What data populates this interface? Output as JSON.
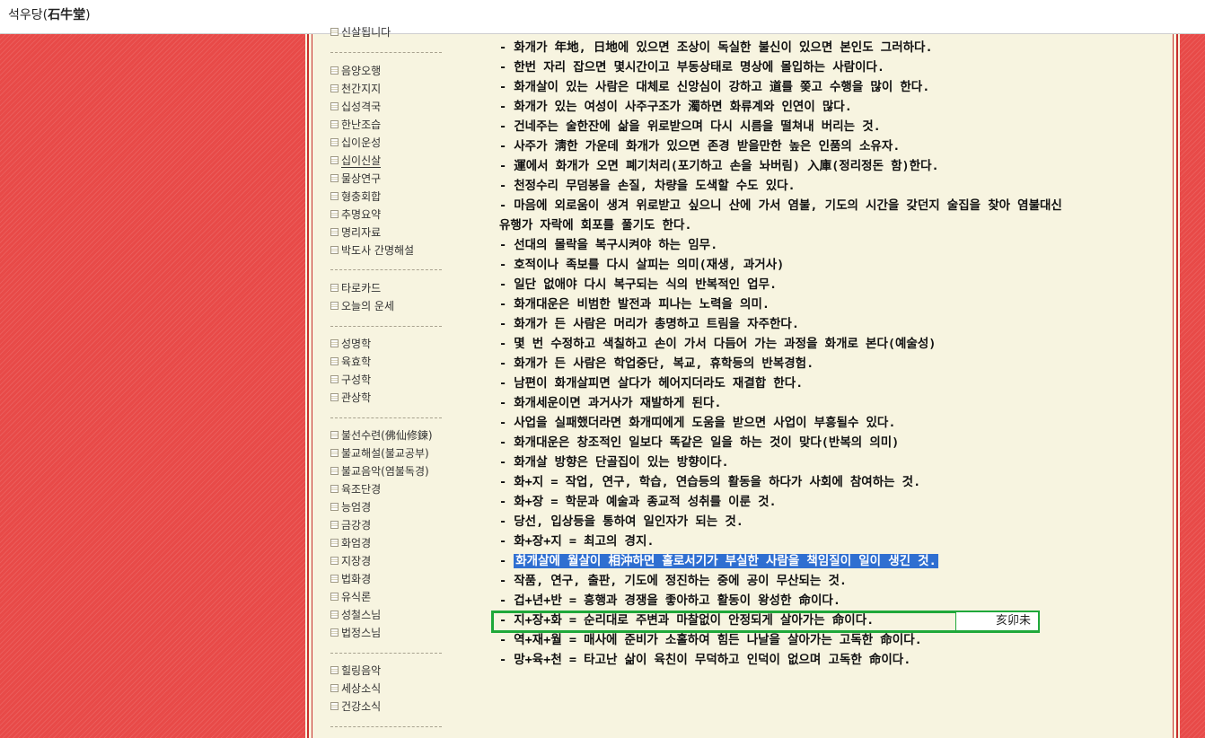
{
  "header": {
    "title_plain": "석우당(",
    "title_bold": "石牛堂",
    "title_end": ")"
  },
  "sidebar": {
    "items": [
      {
        "label": "신살됩니다",
        "active": false
      },
      {
        "label": "음양오행",
        "active": false
      },
      {
        "label": "천간지지",
        "active": false
      },
      {
        "label": "십성격국",
        "active": false
      },
      {
        "label": "한난조습",
        "active": false
      },
      {
        "label": "십이운성",
        "active": false
      },
      {
        "label": "십이신살",
        "active": true
      },
      {
        "label": "물상연구",
        "active": false
      },
      {
        "label": "형충회합",
        "active": false
      },
      {
        "label": "추명요약",
        "active": false
      },
      {
        "label": "명리자료",
        "active": false
      },
      {
        "label": "박도사 간명해설",
        "active": false
      },
      {
        "label": "타로카드",
        "active": false
      },
      {
        "label": "오늘의 운세",
        "active": false
      },
      {
        "label": "성명학",
        "active": false
      },
      {
        "label": "육효학",
        "active": false
      },
      {
        "label": "구성학",
        "active": false
      },
      {
        "label": "관상학",
        "active": false
      },
      {
        "label": "불선수련(佛仙修鍊)",
        "active": false
      },
      {
        "label": "불교해설(불교공부)",
        "active": false
      },
      {
        "label": "불교음악(염불독경)",
        "active": false
      },
      {
        "label": "육조단경",
        "active": false
      },
      {
        "label": "능엄경",
        "active": false
      },
      {
        "label": "금강경",
        "active": false
      },
      {
        "label": "화엄경",
        "active": false
      },
      {
        "label": "지장경",
        "active": false
      },
      {
        "label": "법화경",
        "active": false
      },
      {
        "label": "유식론",
        "active": false
      },
      {
        "label": "성철스님",
        "active": false
      },
      {
        "label": "법정스님",
        "active": false
      },
      {
        "label": "힐링음악",
        "active": false
      },
      {
        "label": "세상소식",
        "active": false
      },
      {
        "label": "건강소식",
        "active": false
      }
    ]
  },
  "content": {
    "lines": [
      "- 화개가 年地, 日地에 있으면 조상이 독실한 불신이 있으면 본인도 그러하다.",
      "- 한번 자리 잡으면 몇시간이고 부동상태로 명상에 몰입하는 사람이다.",
      "- 화개살이 있는 사람은 대체로 신앙심이 강하고 道를 쫒고 수행을 많이 한다.",
      "- 화개가 있는 여성이 사주구조가 濁하면 화류계와 인연이 많다.",
      "- 건네주는 술한잔에 삶을 위로받으며 다시 시름을 떨쳐내 버리는 것.",
      "- 사주가 淸한 가운데 화개가 있으면 존경 받을만한 높은 인품의 소유자.",
      "- 運에서 화개가 오면 폐기처리(포기하고 손을 놔버림) 入庫(정리정돈 함)한다.",
      "- 천정수리 무덤봉을 손질, 차량을 도색할 수도 있다.",
      "- 마음에 외로움이 생겨 위로받고 싶으니 산에 가서 염불, 기도의 시간을 갖던지 술집을 찾아 염불대신",
      "유행가 자락에 회포를 풀기도 한다.",
      "- 선대의 몰락을 복구시켜야 하는 임무.",
      "- 호적이나 족보를 다시 살피는 의미(재생, 과거사)",
      "- 일단 없애야 다시 복구되는 식의 반복적인 업무.",
      "- 화개대운은 비범한 발전과 피나는 노력을 의미.",
      "- 화개가 든 사람은 머리가 총명하고 트림을 자주한다.",
      "- 몇 번 수정하고 색칠하고 손이 가서 다듬어 가는 과정을 화개로 본다(예술성)",
      "- 화개가 든 사람은 학업중단, 복교, 휴학등의 반복경험.",
      "- 남편이 화개살피면 살다가 헤어지더라도 재결합 한다.",
      "- 화개세운이면 과거사가 재발하게 된다.",
      "- 사업을 실패했더라면 화개띠에게 도움을 받으면 사업이 부흥될수 있다.",
      "- 화개대운은 창조적인 일보다 똑같은 일을 하는 것이 맞다(반복의 의미)",
      "- 화개살 방향은 단골집이 있는 방향이다.",
      "- 화+지 = 작업, 연구, 학습, 연습등의 활동을 하다가 사회에 참여하는 것.",
      "- 화+장 = 학문과 예술과 종교적 성취를 이룬 것.",
      "- 당선, 입상등을 통하여 일인자가 되는 것.",
      "- 화+장+지 = 최고의 경지.",
      "- ",
      "- 작품, 연구, 출판, 기도에 정진하는 중에 공이 무산되는 것.",
      "- 겁+년+반 = 흥행과 경쟁을 좋아하고 활동이 왕성한 命이다.",
      "- 지+장+화 = 순리대로 주변과 마찰없이 안정되게 살아가는 命이다.",
      "- 역+재+월 = 매사에 준비가 소홀하여 힘든 나날을 살아가는 고독한 命이다.",
      "- 망+육+천 = 타고난 삶이 육친이 무덕하고 인덕이 없으며 고독한 命이다."
    ],
    "highlighted": "화개살에 월살이 相沖하면 홀로서기가 부실한 사람을 책임질이 일이 생긴 것.",
    "tag": "亥卯未"
  }
}
